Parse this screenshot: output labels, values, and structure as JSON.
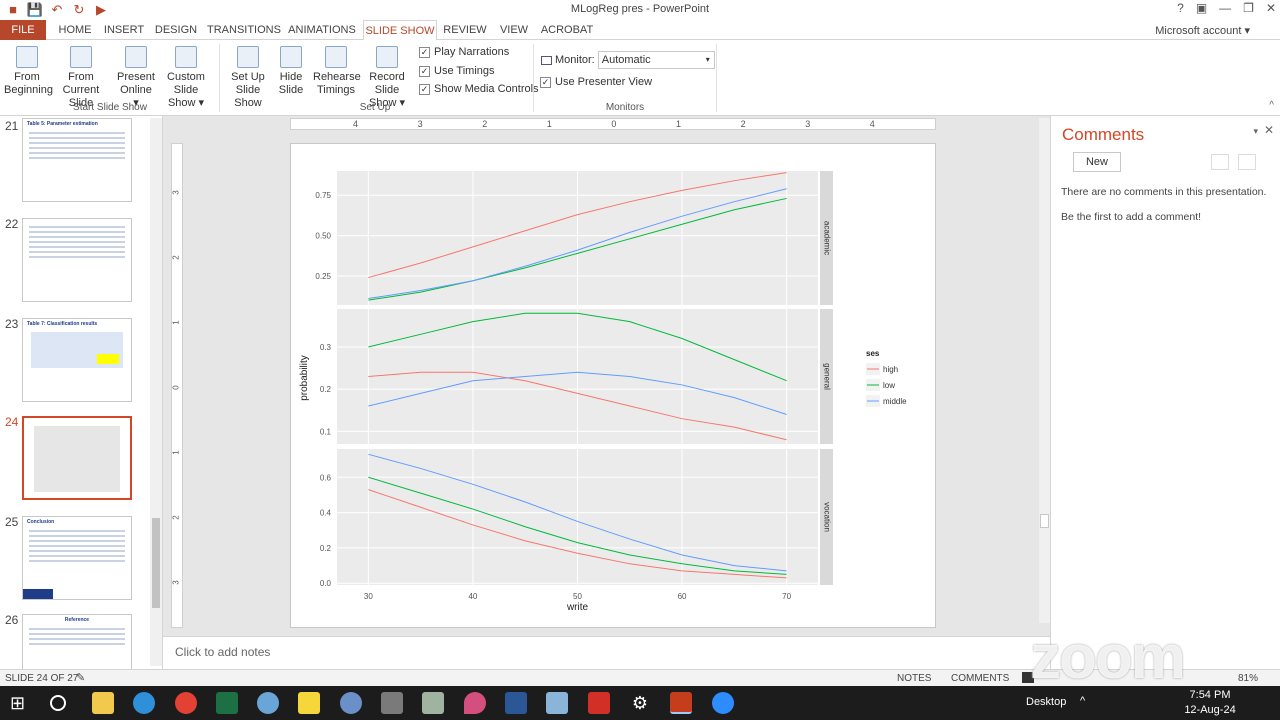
{
  "window": {
    "title": "MLogReg pres - PowerPoint",
    "account": "Microsoft account"
  },
  "tabs": [
    "FILE",
    "HOME",
    "INSERT",
    "DESIGN",
    "TRANSITIONS",
    "ANIMATIONS",
    "SLIDE SHOW",
    "REVIEW",
    "VIEW",
    "ACROBAT"
  ],
  "active_tab": "SLIDE SHOW",
  "ribbon": {
    "start": {
      "from_beginning": [
        "From",
        "Beginning"
      ],
      "from_current": [
        "From",
        "Current Slide"
      ],
      "present_online": [
        "Present",
        "Online ▾"
      ],
      "custom_show": [
        "Custom Slide",
        "Show ▾"
      ],
      "label": "Start Slide Show"
    },
    "setup": {
      "setup_show": [
        "Set Up",
        "Slide Show"
      ],
      "hide_slide": [
        "Hide",
        "Slide"
      ],
      "rehearse": [
        "Rehearse",
        "Timings"
      ],
      "record": [
        "Record Slide",
        "Show ▾"
      ],
      "play_narrations": "Play Narrations",
      "use_timings": "Use Timings",
      "show_media": "Show Media Controls",
      "label": "Set Up"
    },
    "monitors": {
      "monitor_label": "Monitor:",
      "monitor_value": "Automatic",
      "presenter_view": "Use Presenter View",
      "label": "Monitors"
    }
  },
  "thumbnails": [
    {
      "num": "21",
      "title": "Table 5: Parameter estimation"
    },
    {
      "num": "22",
      "title": ""
    },
    {
      "num": "23",
      "title": "Table 7: Classification results"
    },
    {
      "num": "24",
      "title": ""
    },
    {
      "num": "25",
      "title": "Conclusion"
    },
    {
      "num": "26",
      "title": "Reference"
    }
  ],
  "selected_slide": "24",
  "ruler": {
    "h_ticks": [
      "4",
      "3",
      "2",
      "1",
      "0",
      "1",
      "2",
      "3",
      "4"
    ],
    "v_ticks": [
      "3",
      "2",
      "1",
      "0",
      "1",
      "2",
      "3"
    ]
  },
  "notes_placeholder": "Click to add notes",
  "comments": {
    "title": "Comments",
    "new_label": "New",
    "empty_line1": "There are no comments in this presentation.",
    "empty_line2": "Be the first to add a comment!"
  },
  "status": {
    "slide": "SLIDE 24 OF 27",
    "notes": "NOTES",
    "comments": "COMMENTS",
    "zoom": "81%"
  },
  "taskbar": {
    "desktop": "Desktop",
    "time": "7:54 PM",
    "date": "12-Aug-24"
  },
  "watermark": "zoom",
  "colors": {
    "accent": "#b7472a",
    "comments_title": "#d24726"
  },
  "chart_data": {
    "type": "line",
    "xlabel": "write",
    "ylabel": "probability",
    "x_ticks": [
      "30",
      "40",
      "50",
      "60",
      "70"
    ],
    "x": [
      30,
      35,
      40,
      45,
      50,
      55,
      60,
      65,
      70
    ],
    "legend_title": "ses",
    "legend": [
      {
        "name": "high",
        "color": "#f8766d"
      },
      {
        "name": "low",
        "color": "#00ba38"
      },
      {
        "name": "middle",
        "color": "#619cff"
      }
    ],
    "legend_placement": "right",
    "panels": [
      {
        "strip": "academic",
        "ylim": [
          0.07,
          0.9
        ],
        "y_ticks": [
          "0.25",
          "0.50",
          "0.75"
        ],
        "series": [
          {
            "name": "high",
            "values": [
              0.24,
              0.33,
              0.43,
              0.53,
              0.63,
              0.71,
              0.78,
              0.84,
              0.89
            ]
          },
          {
            "name": "low",
            "values": [
              0.1,
              0.15,
              0.22,
              0.3,
              0.39,
              0.48,
              0.57,
              0.66,
              0.73
            ]
          },
          {
            "name": "middle",
            "values": [
              0.11,
              0.16,
              0.22,
              0.31,
              0.41,
              0.52,
              0.62,
              0.71,
              0.79
            ]
          }
        ]
      },
      {
        "strip": "general",
        "ylim": [
          0.07,
          0.39
        ],
        "y_ticks": [
          "0.1",
          "0.2",
          "0.3"
        ],
        "series": [
          {
            "name": "high",
            "values": [
              0.23,
              0.24,
              0.24,
              0.22,
              0.19,
              0.16,
              0.13,
              0.11,
              0.08
            ]
          },
          {
            "name": "low",
            "values": [
              0.3,
              0.33,
              0.36,
              0.38,
              0.38,
              0.36,
              0.32,
              0.27,
              0.22
            ]
          },
          {
            "name": "middle",
            "values": [
              0.16,
              0.19,
              0.22,
              0.23,
              0.24,
              0.23,
              0.21,
              0.18,
              0.14
            ]
          }
        ]
      },
      {
        "strip": "vocation",
        "ylim": [
          -0.01,
          0.76
        ],
        "y_ticks": [
          "0.0",
          "0.2",
          "0.4",
          "0.6"
        ],
        "series": [
          {
            "name": "high",
            "values": [
              0.53,
              0.43,
              0.33,
              0.24,
              0.17,
              0.11,
              0.07,
              0.05,
              0.03
            ]
          },
          {
            "name": "low",
            "values": [
              0.6,
              0.51,
              0.42,
              0.32,
              0.23,
              0.16,
              0.11,
              0.07,
              0.05
            ]
          },
          {
            "name": "middle",
            "values": [
              0.73,
              0.65,
              0.56,
              0.46,
              0.35,
              0.25,
              0.16,
              0.1,
              0.07
            ]
          }
        ]
      }
    ]
  }
}
